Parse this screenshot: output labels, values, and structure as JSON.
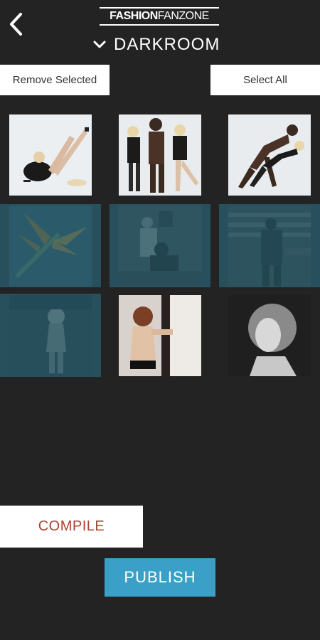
{
  "header": {
    "logo_bold": "FASHION",
    "logo_thin": "FANZONE",
    "title": "DARKROOM",
    "back_icon": "chevron-left-icon",
    "dropdown_icon": "chevron-down-icon"
  },
  "actions": {
    "remove_selected": "Remove Selected",
    "select_all": "Select All"
  },
  "gallery": {
    "items": [
      {
        "selected": false,
        "icon": "photo-thumbnail"
      },
      {
        "selected": false,
        "icon": "photo-thumbnail"
      },
      {
        "selected": false,
        "icon": "photo-thumbnail"
      },
      {
        "selected": true,
        "icon": "photo-thumbnail"
      },
      {
        "selected": true,
        "icon": "photo-thumbnail"
      },
      {
        "selected": true,
        "icon": "photo-thumbnail"
      },
      {
        "selected": true,
        "icon": "photo-thumbnail"
      },
      {
        "selected": false,
        "icon": "photo-thumbnail"
      },
      {
        "selected": false,
        "icon": "photo-thumbnail"
      }
    ]
  },
  "footer": {
    "compile": "COMPILE",
    "publish": "PUBLISH"
  },
  "colors": {
    "background": "#232323",
    "selected_overlay": "#27505c",
    "publish": "#3aa0c7",
    "compile_text": "#b0402f"
  }
}
